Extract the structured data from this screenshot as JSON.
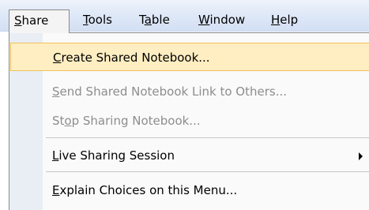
{
  "menubar": {
    "items": [
      {
        "accel": "S",
        "rest": "hare"
      },
      {
        "accel": "T",
        "rest": "ools"
      },
      {
        "pre": "T",
        "accel": "a",
        "rest": "ble"
      },
      {
        "accel": "W",
        "rest": "indow"
      },
      {
        "accel": "H",
        "rest": "elp"
      }
    ]
  },
  "share_menu": {
    "items": [
      {
        "accel": "C",
        "rest": "reate Shared Notebook...",
        "state": "highlighted"
      },
      {
        "accel": "S",
        "rest": "end Shared Notebook Link to Others...",
        "state": "disabled"
      },
      {
        "pre": "St",
        "accel": "o",
        "rest": "p Sharing Notebook...",
        "state": "disabled"
      },
      {
        "accel": "L",
        "rest": "ive Sharing Session",
        "state": "enabled",
        "submenu_icon": "chevron-right-icon"
      },
      {
        "accel": "E",
        "rest": "xplain Choices on this Menu...",
        "state": "enabled"
      }
    ]
  },
  "colors": {
    "highlight_bg": "#ffeec2",
    "highlight_border": "#f1c156",
    "disabled_text": "#8d8d8d",
    "gutter": "#e9eef5"
  }
}
